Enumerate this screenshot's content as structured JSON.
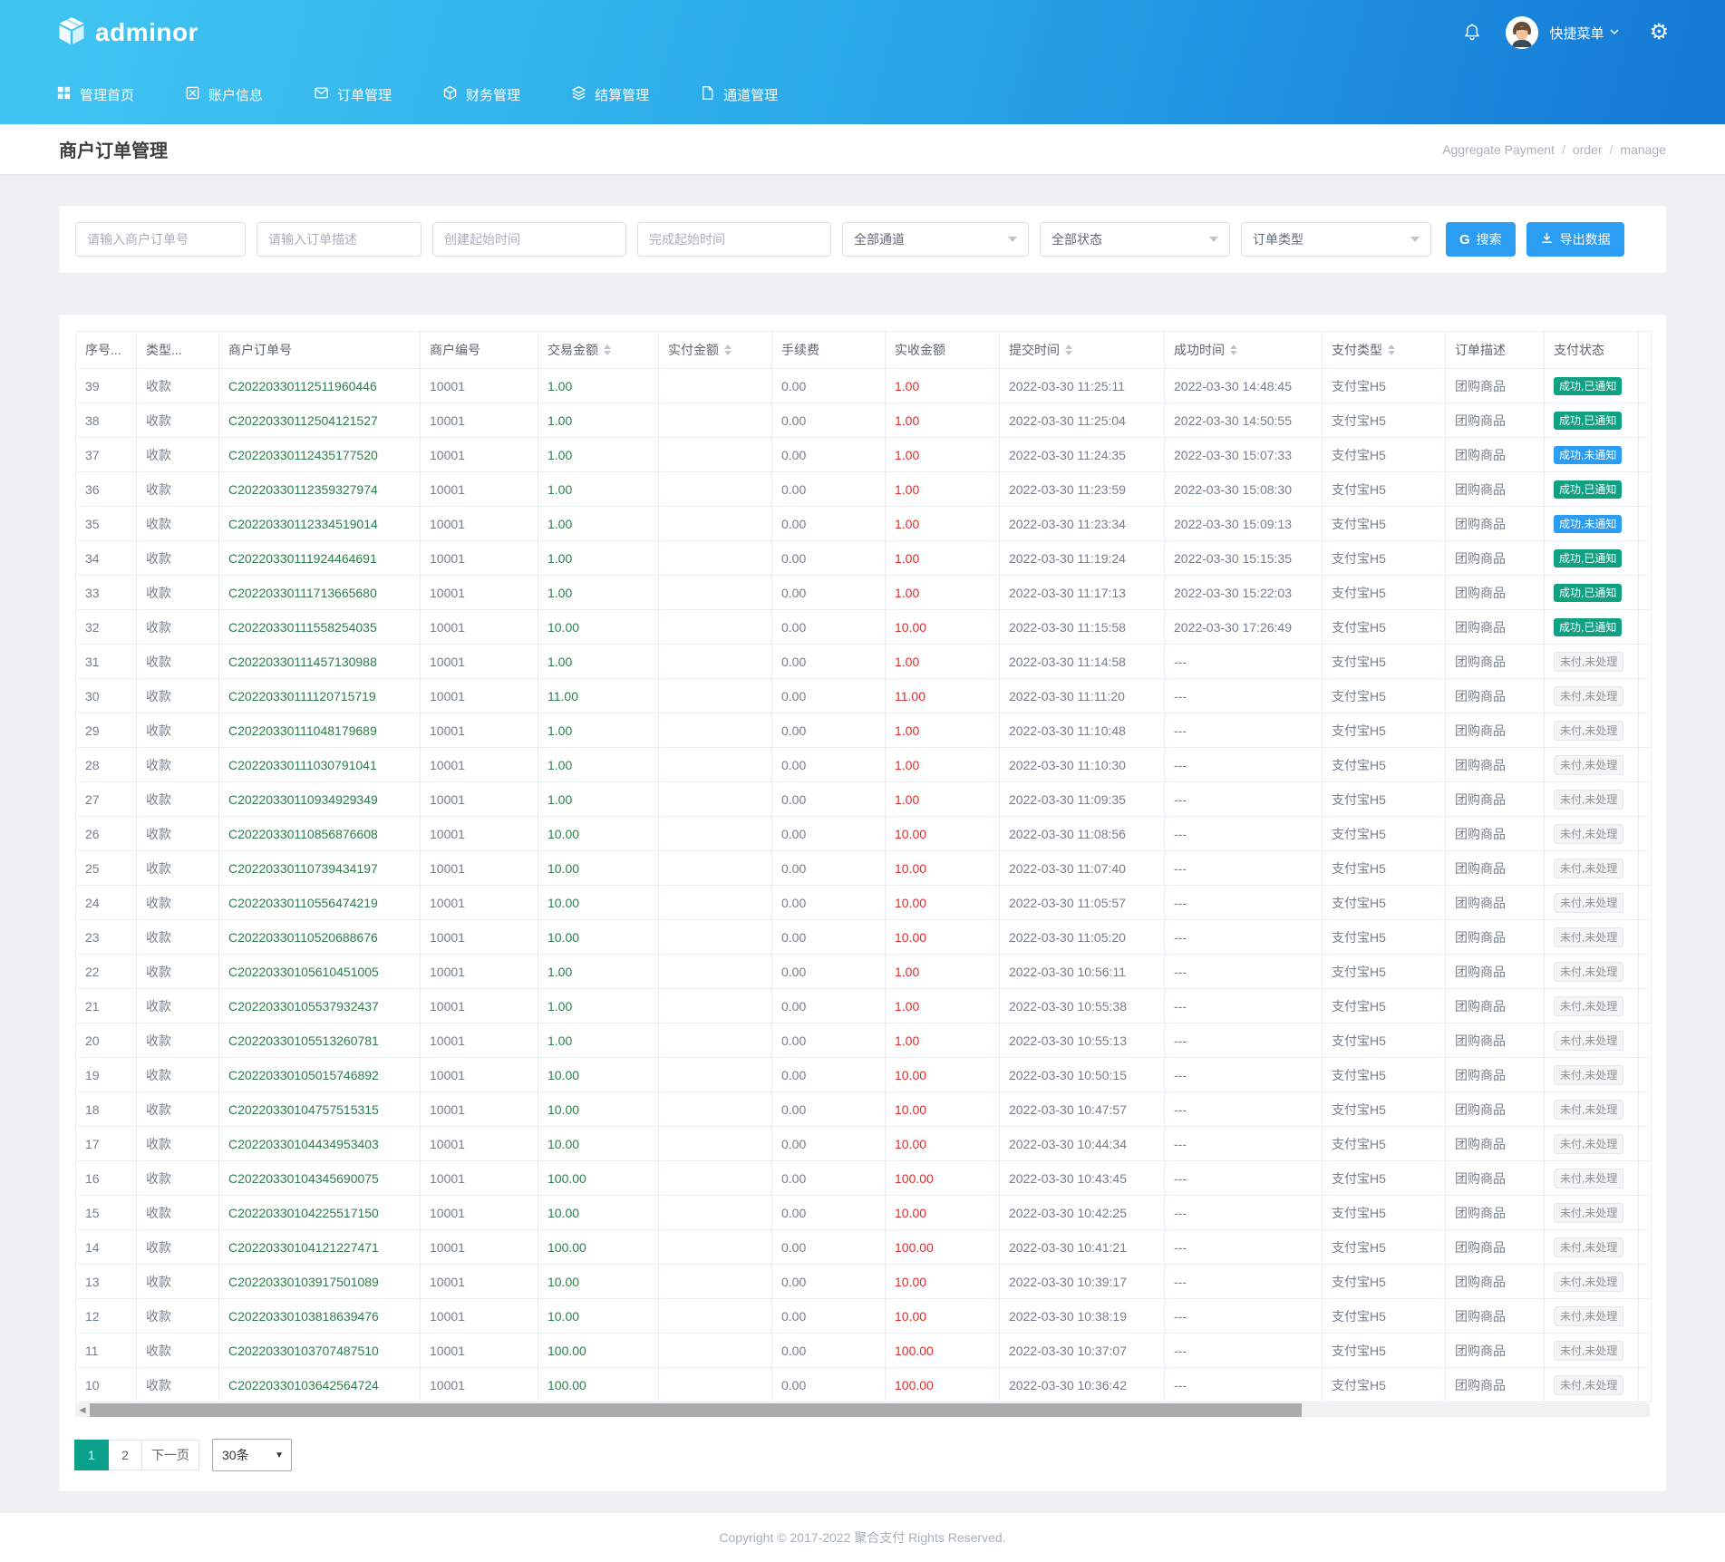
{
  "header": {
    "logo_text": "adminor",
    "icons": {
      "logo": "package-box-icon",
      "notification": "bell-icon",
      "user_dropdown": "chevron-down-icon",
      "settings": "gear-icon"
    },
    "user_menu_label": "快捷菜单",
    "nav_items": [
      {
        "icon": "grid-icon",
        "label": "管理首页"
      },
      {
        "icon": "account-icon",
        "label": "账户信息"
      },
      {
        "icon": "mail-icon",
        "label": "订单管理"
      },
      {
        "icon": "cube-icon",
        "label": "财务管理"
      },
      {
        "icon": "layers-icon",
        "label": "结算管理"
      },
      {
        "icon": "file-icon",
        "label": "通道管理"
      }
    ]
  },
  "page": {
    "title": "商户订单管理",
    "breadcrumb": [
      "Aggregate Payment",
      "order",
      "manage"
    ]
  },
  "filters": {
    "order_no_placeholder": "请输入商户订单号",
    "order_desc_placeholder": "请输入订单描述",
    "create_time_placeholder": "创建起始时间",
    "finish_time_placeholder": "完成起始时间",
    "channel_select_value": "全部通道",
    "status_select_value": "全部状态",
    "order_type_select_value": "订单类型",
    "search_button_icon_text": "G",
    "search_button_label": "搜索",
    "export_button_label": "导出数据"
  },
  "colors": {
    "header_gradient_start": "#41c6f2",
    "header_gradient_end": "#1478d5",
    "primary_button": "#2b9df3",
    "badge_success_notified": "#0fa182",
    "badge_success_unnotified": "#2b9df3",
    "badge_unpaid_text": "#909399",
    "pagination_active": "#0aa08a",
    "amount_green": "#2e7d4e",
    "amount_red": "#e02b2b"
  },
  "table": {
    "columns": [
      {
        "key": "seq",
        "label": "序号...",
        "sortable": false
      },
      {
        "key": "type",
        "label": "类型...",
        "sortable": false
      },
      {
        "key": "order_no",
        "label": "商户订单号",
        "sortable": false
      },
      {
        "key": "merchant_no",
        "label": "商户编号",
        "sortable": false
      },
      {
        "key": "trade_amount",
        "label": "交易金额",
        "sortable": true
      },
      {
        "key": "paid_amount",
        "label": "实付金额",
        "sortable": true
      },
      {
        "key": "fee",
        "label": "手续费",
        "sortable": false
      },
      {
        "key": "received_amount",
        "label": "实收金额",
        "sortable": false
      },
      {
        "key": "submit_time",
        "label": "提交时间",
        "sortable": true
      },
      {
        "key": "success_time",
        "label": "成功时间",
        "sortable": true
      },
      {
        "key": "pay_type",
        "label": "支付类型",
        "sortable": true
      },
      {
        "key": "order_desc",
        "label": "订单描述",
        "sortable": false
      },
      {
        "key": "status",
        "label": "支付状态",
        "sortable": false
      }
    ],
    "rows": [
      {
        "seq": "39",
        "type": "收款",
        "order_no": "C20220330112511960446",
        "merchant_no": "10001",
        "trade_amount": "1.00",
        "paid_amount": "",
        "fee": "0.00",
        "received_amount": "1.00",
        "submit_time": "2022-03-30 11:25:11",
        "success_time": "2022-03-30 14:48:45",
        "pay_type": "支付宝H5",
        "order_desc": "团购商品",
        "status": "成功,已通知",
        "status_kind": "success-notified"
      },
      {
        "seq": "38",
        "type": "收款",
        "order_no": "C20220330112504121527",
        "merchant_no": "10001",
        "trade_amount": "1.00",
        "paid_amount": "",
        "fee": "0.00",
        "received_amount": "1.00",
        "submit_time": "2022-03-30 11:25:04",
        "success_time": "2022-03-30 14:50:55",
        "pay_type": "支付宝H5",
        "order_desc": "团购商品",
        "status": "成功,已通知",
        "status_kind": "success-notified"
      },
      {
        "seq": "37",
        "type": "收款",
        "order_no": "C20220330112435177520",
        "merchant_no": "10001",
        "trade_amount": "1.00",
        "paid_amount": "",
        "fee": "0.00",
        "received_amount": "1.00",
        "submit_time": "2022-03-30 11:24:35",
        "success_time": "2022-03-30 15:07:33",
        "pay_type": "支付宝H5",
        "order_desc": "团购商品",
        "status": "成功,未通知",
        "status_kind": "success-unnotified"
      },
      {
        "seq": "36",
        "type": "收款",
        "order_no": "C20220330112359327974",
        "merchant_no": "10001",
        "trade_amount": "1.00",
        "paid_amount": "",
        "fee": "0.00",
        "received_amount": "1.00",
        "submit_time": "2022-03-30 11:23:59",
        "success_time": "2022-03-30 15:08:30",
        "pay_type": "支付宝H5",
        "order_desc": "团购商品",
        "status": "成功,已通知",
        "status_kind": "success-notified"
      },
      {
        "seq": "35",
        "type": "收款",
        "order_no": "C20220330112334519014",
        "merchant_no": "10001",
        "trade_amount": "1.00",
        "paid_amount": "",
        "fee": "0.00",
        "received_amount": "1.00",
        "submit_time": "2022-03-30 11:23:34",
        "success_time": "2022-03-30 15:09:13",
        "pay_type": "支付宝H5",
        "order_desc": "团购商品",
        "status": "成功,未通知",
        "status_kind": "success-unnotified"
      },
      {
        "seq": "34",
        "type": "收款",
        "order_no": "C20220330111924464691",
        "merchant_no": "10001",
        "trade_amount": "1.00",
        "paid_amount": "",
        "fee": "0.00",
        "received_amount": "1.00",
        "submit_time": "2022-03-30 11:19:24",
        "success_time": "2022-03-30 15:15:35",
        "pay_type": "支付宝H5",
        "order_desc": "团购商品",
        "status": "成功,已通知",
        "status_kind": "success-notified"
      },
      {
        "seq": "33",
        "type": "收款",
        "order_no": "C20220330111713665680",
        "merchant_no": "10001",
        "trade_amount": "1.00",
        "paid_amount": "",
        "fee": "0.00",
        "received_amount": "1.00",
        "submit_time": "2022-03-30 11:17:13",
        "success_time": "2022-03-30 15:22:03",
        "pay_type": "支付宝H5",
        "order_desc": "团购商品",
        "status": "成功,已通知",
        "status_kind": "success-notified"
      },
      {
        "seq": "32",
        "type": "收款",
        "order_no": "C20220330111558254035",
        "merchant_no": "10001",
        "trade_amount": "10.00",
        "paid_amount": "",
        "fee": "0.00",
        "received_amount": "10.00",
        "submit_time": "2022-03-30 11:15:58",
        "success_time": "2022-03-30 17:26:49",
        "pay_type": "支付宝H5",
        "order_desc": "团购商品",
        "status": "成功,已通知",
        "status_kind": "success-notified"
      },
      {
        "seq": "31",
        "type": "收款",
        "order_no": "C20220330111457130988",
        "merchant_no": "10001",
        "trade_amount": "1.00",
        "paid_amount": "",
        "fee": "0.00",
        "received_amount": "1.00",
        "submit_time": "2022-03-30 11:14:58",
        "success_time": "---",
        "pay_type": "支付宝H5",
        "order_desc": "团购商品",
        "status": "未付,未处理",
        "status_kind": "unpaid"
      },
      {
        "seq": "30",
        "type": "收款",
        "order_no": "C20220330111120715719",
        "merchant_no": "10001",
        "trade_amount": "11.00",
        "paid_amount": "",
        "fee": "0.00",
        "received_amount": "11.00",
        "submit_time": "2022-03-30 11:11:20",
        "success_time": "---",
        "pay_type": "支付宝H5",
        "order_desc": "团购商品",
        "status": "未付,未处理",
        "status_kind": "unpaid"
      },
      {
        "seq": "29",
        "type": "收款",
        "order_no": "C20220330111048179689",
        "merchant_no": "10001",
        "trade_amount": "1.00",
        "paid_amount": "",
        "fee": "0.00",
        "received_amount": "1.00",
        "submit_time": "2022-03-30 11:10:48",
        "success_time": "---",
        "pay_type": "支付宝H5",
        "order_desc": "团购商品",
        "status": "未付,未处理",
        "status_kind": "unpaid"
      },
      {
        "seq": "28",
        "type": "收款",
        "order_no": "C20220330111030791041",
        "merchant_no": "10001",
        "trade_amount": "1.00",
        "paid_amount": "",
        "fee": "0.00",
        "received_amount": "1.00",
        "submit_time": "2022-03-30 11:10:30",
        "success_time": "---",
        "pay_type": "支付宝H5",
        "order_desc": "团购商品",
        "status": "未付,未处理",
        "status_kind": "unpaid"
      },
      {
        "seq": "27",
        "type": "收款",
        "order_no": "C20220330110934929349",
        "merchant_no": "10001",
        "trade_amount": "1.00",
        "paid_amount": "",
        "fee": "0.00",
        "received_amount": "1.00",
        "submit_time": "2022-03-30 11:09:35",
        "success_time": "---",
        "pay_type": "支付宝H5",
        "order_desc": "团购商品",
        "status": "未付,未处理",
        "status_kind": "unpaid"
      },
      {
        "seq": "26",
        "type": "收款",
        "order_no": "C20220330110856876608",
        "merchant_no": "10001",
        "trade_amount": "10.00",
        "paid_amount": "",
        "fee": "0.00",
        "received_amount": "10.00",
        "submit_time": "2022-03-30 11:08:56",
        "success_time": "---",
        "pay_type": "支付宝H5",
        "order_desc": "团购商品",
        "status": "未付,未处理",
        "status_kind": "unpaid"
      },
      {
        "seq": "25",
        "type": "收款",
        "order_no": "C20220330110739434197",
        "merchant_no": "10001",
        "trade_amount": "10.00",
        "paid_amount": "",
        "fee": "0.00",
        "received_amount": "10.00",
        "submit_time": "2022-03-30 11:07:40",
        "success_time": "---",
        "pay_type": "支付宝H5",
        "order_desc": "团购商品",
        "status": "未付,未处理",
        "status_kind": "unpaid"
      },
      {
        "seq": "24",
        "type": "收款",
        "order_no": "C20220330110556474219",
        "merchant_no": "10001",
        "trade_amount": "10.00",
        "paid_amount": "",
        "fee": "0.00",
        "received_amount": "10.00",
        "submit_time": "2022-03-30 11:05:57",
        "success_time": "---",
        "pay_type": "支付宝H5",
        "order_desc": "团购商品",
        "status": "未付,未处理",
        "status_kind": "unpaid"
      },
      {
        "seq": "23",
        "type": "收款",
        "order_no": "C20220330110520688676",
        "merchant_no": "10001",
        "trade_amount": "10.00",
        "paid_amount": "",
        "fee": "0.00",
        "received_amount": "10.00",
        "submit_time": "2022-03-30 11:05:20",
        "success_time": "---",
        "pay_type": "支付宝H5",
        "order_desc": "团购商品",
        "status": "未付,未处理",
        "status_kind": "unpaid"
      },
      {
        "seq": "22",
        "type": "收款",
        "order_no": "C20220330105610451005",
        "merchant_no": "10001",
        "trade_amount": "1.00",
        "paid_amount": "",
        "fee": "0.00",
        "received_amount": "1.00",
        "submit_time": "2022-03-30 10:56:11",
        "success_time": "---",
        "pay_type": "支付宝H5",
        "order_desc": "团购商品",
        "status": "未付,未处理",
        "status_kind": "unpaid"
      },
      {
        "seq": "21",
        "type": "收款",
        "order_no": "C20220330105537932437",
        "merchant_no": "10001",
        "trade_amount": "1.00",
        "paid_amount": "",
        "fee": "0.00",
        "received_amount": "1.00",
        "submit_time": "2022-03-30 10:55:38",
        "success_time": "---",
        "pay_type": "支付宝H5",
        "order_desc": "团购商品",
        "status": "未付,未处理",
        "status_kind": "unpaid"
      },
      {
        "seq": "20",
        "type": "收款",
        "order_no": "C20220330105513260781",
        "merchant_no": "10001",
        "trade_amount": "1.00",
        "paid_amount": "",
        "fee": "0.00",
        "received_amount": "1.00",
        "submit_time": "2022-03-30 10:55:13",
        "success_time": "---",
        "pay_type": "支付宝H5",
        "order_desc": "团购商品",
        "status": "未付,未处理",
        "status_kind": "unpaid"
      },
      {
        "seq": "19",
        "type": "收款",
        "order_no": "C20220330105015746892",
        "merchant_no": "10001",
        "trade_amount": "10.00",
        "paid_amount": "",
        "fee": "0.00",
        "received_amount": "10.00",
        "submit_time": "2022-03-30 10:50:15",
        "success_time": "---",
        "pay_type": "支付宝H5",
        "order_desc": "团购商品",
        "status": "未付,未处理",
        "status_kind": "unpaid"
      },
      {
        "seq": "18",
        "type": "收款",
        "order_no": "C20220330104757515315",
        "merchant_no": "10001",
        "trade_amount": "10.00",
        "paid_amount": "",
        "fee": "0.00",
        "received_amount": "10.00",
        "submit_time": "2022-03-30 10:47:57",
        "success_time": "---",
        "pay_type": "支付宝H5",
        "order_desc": "团购商品",
        "status": "未付,未处理",
        "status_kind": "unpaid"
      },
      {
        "seq": "17",
        "type": "收款",
        "order_no": "C20220330104434953403",
        "merchant_no": "10001",
        "trade_amount": "10.00",
        "paid_amount": "",
        "fee": "0.00",
        "received_amount": "10.00",
        "submit_time": "2022-03-30 10:44:34",
        "success_time": "---",
        "pay_type": "支付宝H5",
        "order_desc": "团购商品",
        "status": "未付,未处理",
        "status_kind": "unpaid"
      },
      {
        "seq": "16",
        "type": "收款",
        "order_no": "C20220330104345690075",
        "merchant_no": "10001",
        "trade_amount": "100.00",
        "paid_amount": "",
        "fee": "0.00",
        "received_amount": "100.00",
        "submit_time": "2022-03-30 10:43:45",
        "success_time": "---",
        "pay_type": "支付宝H5",
        "order_desc": "团购商品",
        "status": "未付,未处理",
        "status_kind": "unpaid"
      },
      {
        "seq": "15",
        "type": "收款",
        "order_no": "C20220330104225517150",
        "merchant_no": "10001",
        "trade_amount": "10.00",
        "paid_amount": "",
        "fee": "0.00",
        "received_amount": "10.00",
        "submit_time": "2022-03-30 10:42:25",
        "success_time": "---",
        "pay_type": "支付宝H5",
        "order_desc": "团购商品",
        "status": "未付,未处理",
        "status_kind": "unpaid"
      },
      {
        "seq": "14",
        "type": "收款",
        "order_no": "C20220330104121227471",
        "merchant_no": "10001",
        "trade_amount": "100.00",
        "paid_amount": "",
        "fee": "0.00",
        "received_amount": "100.00",
        "submit_time": "2022-03-30 10:41:21",
        "success_time": "---",
        "pay_type": "支付宝H5",
        "order_desc": "团购商品",
        "status": "未付,未处理",
        "status_kind": "unpaid"
      },
      {
        "seq": "13",
        "type": "收款",
        "order_no": "C20220330103917501089",
        "merchant_no": "10001",
        "trade_amount": "10.00",
        "paid_amount": "",
        "fee": "0.00",
        "received_amount": "10.00",
        "submit_time": "2022-03-30 10:39:17",
        "success_time": "---",
        "pay_type": "支付宝H5",
        "order_desc": "团购商品",
        "status": "未付,未处理",
        "status_kind": "unpaid"
      },
      {
        "seq": "12",
        "type": "收款",
        "order_no": "C20220330103818639476",
        "merchant_no": "10001",
        "trade_amount": "10.00",
        "paid_amount": "",
        "fee": "0.00",
        "received_amount": "10.00",
        "submit_time": "2022-03-30 10:38:19",
        "success_time": "---",
        "pay_type": "支付宝H5",
        "order_desc": "团购商品",
        "status": "未付,未处理",
        "status_kind": "unpaid"
      },
      {
        "seq": "11",
        "type": "收款",
        "order_no": "C20220330103707487510",
        "merchant_no": "10001",
        "trade_amount": "100.00",
        "paid_amount": "",
        "fee": "0.00",
        "received_amount": "100.00",
        "submit_time": "2022-03-30 10:37:07",
        "success_time": "---",
        "pay_type": "支付宝H5",
        "order_desc": "团购商品",
        "status": "未付,未处理",
        "status_kind": "unpaid"
      },
      {
        "seq": "10",
        "type": "收款",
        "order_no": "C20220330103642564724",
        "merchant_no": "10001",
        "trade_amount": "100.00",
        "paid_amount": "",
        "fee": "0.00",
        "received_amount": "100.00",
        "submit_time": "2022-03-30 10:36:42",
        "success_time": "---",
        "pay_type": "支付宝H5",
        "order_desc": "团购商品",
        "status": "未付,未处理",
        "status_kind": "unpaid"
      }
    ]
  },
  "pagination": {
    "page_1_label": "1",
    "page_2_label": "2",
    "next_label": "下一页",
    "page_size_label": "30条"
  },
  "footer": {
    "copyright_text": "Copyright © 2017-2022 聚合支付 Rights Reserved."
  }
}
